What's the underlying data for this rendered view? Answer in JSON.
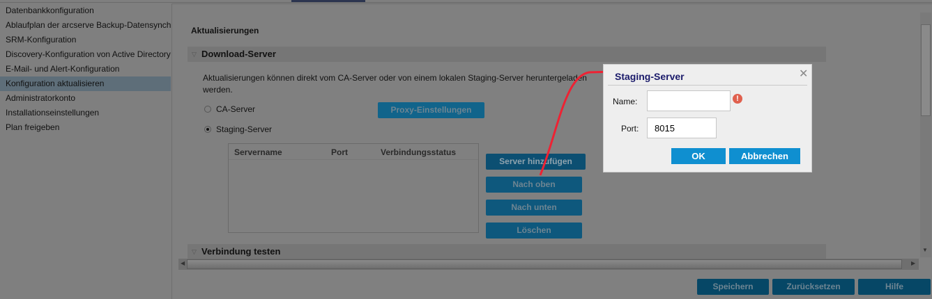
{
  "sidebar": {
    "items": [
      {
        "label": "Datenbankkonfiguration"
      },
      {
        "label": "Ablaufplan der arcserve Backup-Datensynchronisation"
      },
      {
        "label": "SRM-Konfiguration"
      },
      {
        "label": "Discovery-Konfiguration von Active Directory"
      },
      {
        "label": "E-Mail- und Alert-Konfiguration"
      },
      {
        "label": "Konfiguration aktualisieren",
        "selected": true
      },
      {
        "label": "Administratorkonto"
      },
      {
        "label": "Installationseinstellungen"
      },
      {
        "label": "Plan freigeben"
      }
    ]
  },
  "main": {
    "title": "Aktualisierungen",
    "download_section": "Download-Server",
    "description": "Aktualisierungen können direkt vom CA-Server oder von einem lokalen Staging-Server heruntergeladen werden.",
    "radio_ca": "CA-Server",
    "radio_staging": "Staging-Server",
    "selected_radio": "Staging-Server",
    "proxy_button": "Proxy-Einstellungen",
    "grid_columns": [
      "Servername",
      "Port",
      "Verbindungsstatus"
    ],
    "add_server": "Server hinzufügen",
    "move_up": "Nach oben",
    "move_down": "Nach unten",
    "delete": "Löschen",
    "test_section": "Verbindung testen"
  },
  "footer": {
    "save": "Speichern",
    "reset": "Zurücksetzen",
    "help": "Hilfe"
  },
  "dialog": {
    "title": "Staging-Server",
    "name_label": "Name:",
    "name_value": "",
    "port_label": "Port:",
    "port_value": "8015",
    "ok": "OK",
    "cancel": "Abbrechen",
    "close_icon": "close-icon",
    "error_icon": "exclamation-circle-icon"
  },
  "colors": {
    "accent": "#0f8fd0",
    "annotation": "#ee2233"
  }
}
